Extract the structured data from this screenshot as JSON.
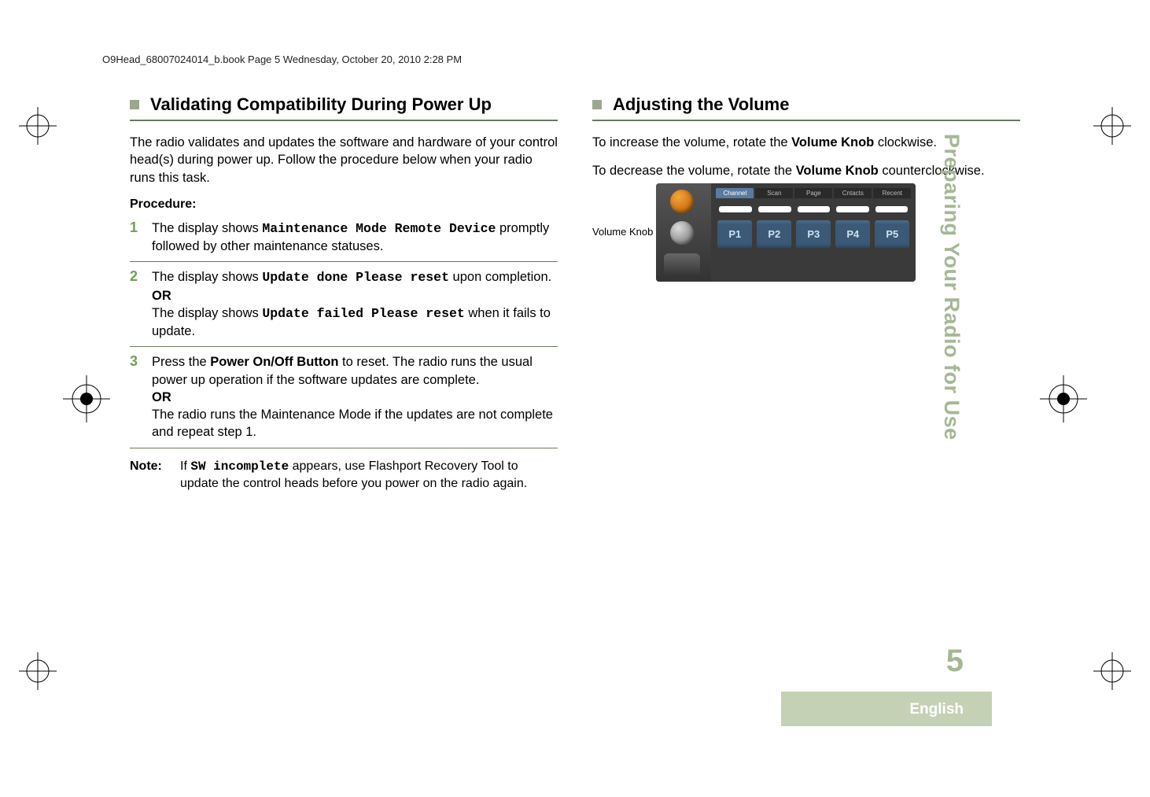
{
  "header_line": "O9Head_68007024014_b.book  Page 5  Wednesday, October 20, 2010  2:28 PM",
  "left": {
    "title": "Validating Compatibility During Power Up",
    "intro": "The radio validates and updates the software and hardware of your control head(s) during power up. Follow the procedure below when your radio runs this task.",
    "procedure_label": "Procedure:",
    "step1_a": "The display shows ",
    "step1_mono": "Maintenance Mode Remote Device",
    "step1_b": " promptly followed by other maintenance statuses.",
    "step2_a": "The display shows ",
    "step2_mono1": "Update done Please reset",
    "step2_b": " upon completion.",
    "step2_or": "OR",
    "step2_c": "The display shows ",
    "step2_mono2": "Update failed Please reset",
    "step2_d": " when it fails to update.",
    "step3_a": "Press the ",
    "step3_bold": "Power On/Off Button",
    "step3_b": " to reset. The radio runs the usual power up operation if the software updates are complete.",
    "step3_or": "OR",
    "step3_c": "The radio runs the Maintenance Mode if the updates are not complete and repeat step 1.",
    "note_label": "Note:",
    "note_a": "If ",
    "note_mono": "SW incomplete",
    "note_b": " appears, use Flashport Recovery Tool to update the control heads before you power on the radio again."
  },
  "right": {
    "title": "Adjusting the Volume",
    "p1_a": "To increase the volume, rotate the ",
    "p1_bold": "Volume Knob",
    "p1_b": " clockwise.",
    "p2_a": "To decrease the volume, rotate the ",
    "p2_bold": "Volume Knob",
    "p2_b": " counterclockwise.",
    "fig_label": "Volume Knob",
    "tabs": [
      "Channel",
      "Scan",
      "Page",
      "Cntacts",
      "Recent"
    ],
    "pbtns": [
      "P1",
      "P2",
      "P3",
      "P4",
      "P5"
    ]
  },
  "sidebar_text": "Preparing Your Radio for Use",
  "page_number": "5",
  "footer_language": "English"
}
